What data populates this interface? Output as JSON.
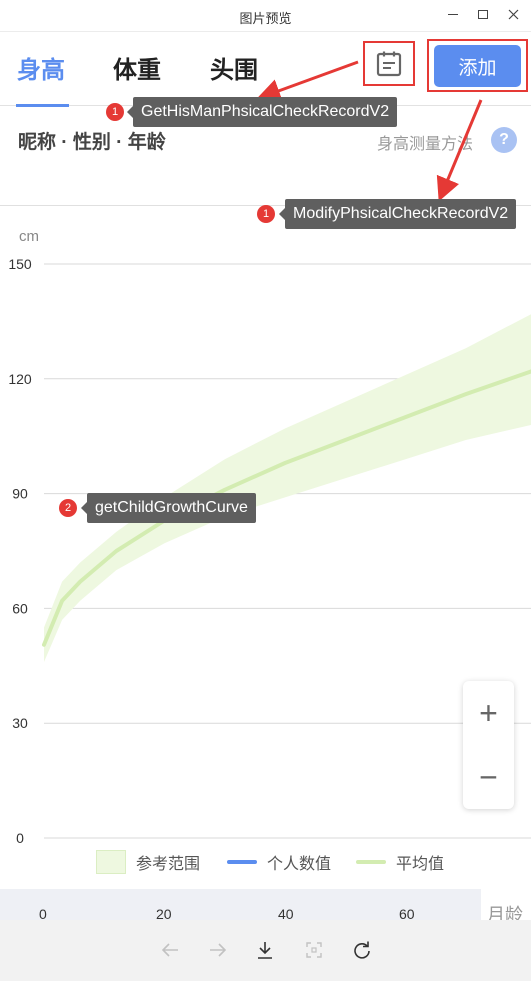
{
  "window": {
    "title": "图片预览"
  },
  "tabs": [
    {
      "label": "身高",
      "active": true
    },
    {
      "label": "体重",
      "active": false
    },
    {
      "label": "头围",
      "active": false
    }
  ],
  "header": {
    "add_label": "添加"
  },
  "info": {
    "title": "昵称 · 性别 · 年龄",
    "measure_label": "身高测量方法",
    "help_symbol": "?"
  },
  "chart_data": {
    "type": "area",
    "unit": "cm",
    "y_ticks": [
      "0",
      "30",
      "60",
      "90",
      "120",
      "150"
    ],
    "x_ticks": [
      "0",
      "20",
      "40",
      "60"
    ],
    "x_unit": "月龄",
    "ylim": [
      0,
      150
    ],
    "xlim": [
      0,
      81
    ],
    "series": [
      {
        "name": "参考范围",
        "kind": "band",
        "x": [
          0,
          3,
          6,
          12,
          20,
          30,
          40,
          50,
          60,
          70,
          81
        ],
        "low": [
          46,
          57,
          62,
          70,
          77,
          84,
          89,
          94,
          99,
          104,
          108
        ],
        "high": [
          55,
          67,
          72,
          80,
          89,
          99,
          107,
          114,
          121,
          128,
          137
        ]
      },
      {
        "name": "个人数值",
        "kind": "line",
        "x": [],
        "y": []
      },
      {
        "name": "平均值",
        "kind": "line",
        "x": [
          0,
          3,
          6,
          12,
          20,
          30,
          40,
          50,
          60,
          70,
          81
        ],
        "y": [
          50.5,
          62,
          67,
          75,
          83,
          91,
          98,
          104,
          110,
          116,
          122
        ]
      }
    ],
    "grid": true,
    "legend_position": "bottom",
    "colors": {
      "band": "#eef8e0",
      "average": "#d3ecb1",
      "personal": "#5b8def",
      "grid": "#d9d9d9"
    }
  },
  "legend": [
    {
      "label": "参考范围",
      "swatch": "range",
      "color": "#eef8e0"
    },
    {
      "label": "个人数值",
      "swatch": "line",
      "color": "#5b8def"
    },
    {
      "label": "平均值",
      "swatch": "line",
      "color": "#d3ecb1"
    }
  ],
  "zoom": {
    "in_symbol": "+",
    "out_symbol": "−"
  },
  "toolbar": {
    "items": [
      {
        "icon": "arrow-left-icon",
        "enabled": false
      },
      {
        "icon": "arrow-right-icon",
        "enabled": false
      },
      {
        "icon": "download-icon",
        "enabled": true
      },
      {
        "icon": "fit-screen-icon",
        "enabled": false
      },
      {
        "icon": "rotate-icon",
        "enabled": true
      }
    ]
  },
  "annotations": [
    {
      "badge": "1",
      "label": "GetHisManPhsicalCheckRecordV2"
    },
    {
      "badge": "1",
      "label": "ModifyPhsicalCheckRecordV2"
    },
    {
      "badge": "2",
      "label": "getChildGrowthCurve"
    }
  ],
  "annotation_color": "#e53935"
}
